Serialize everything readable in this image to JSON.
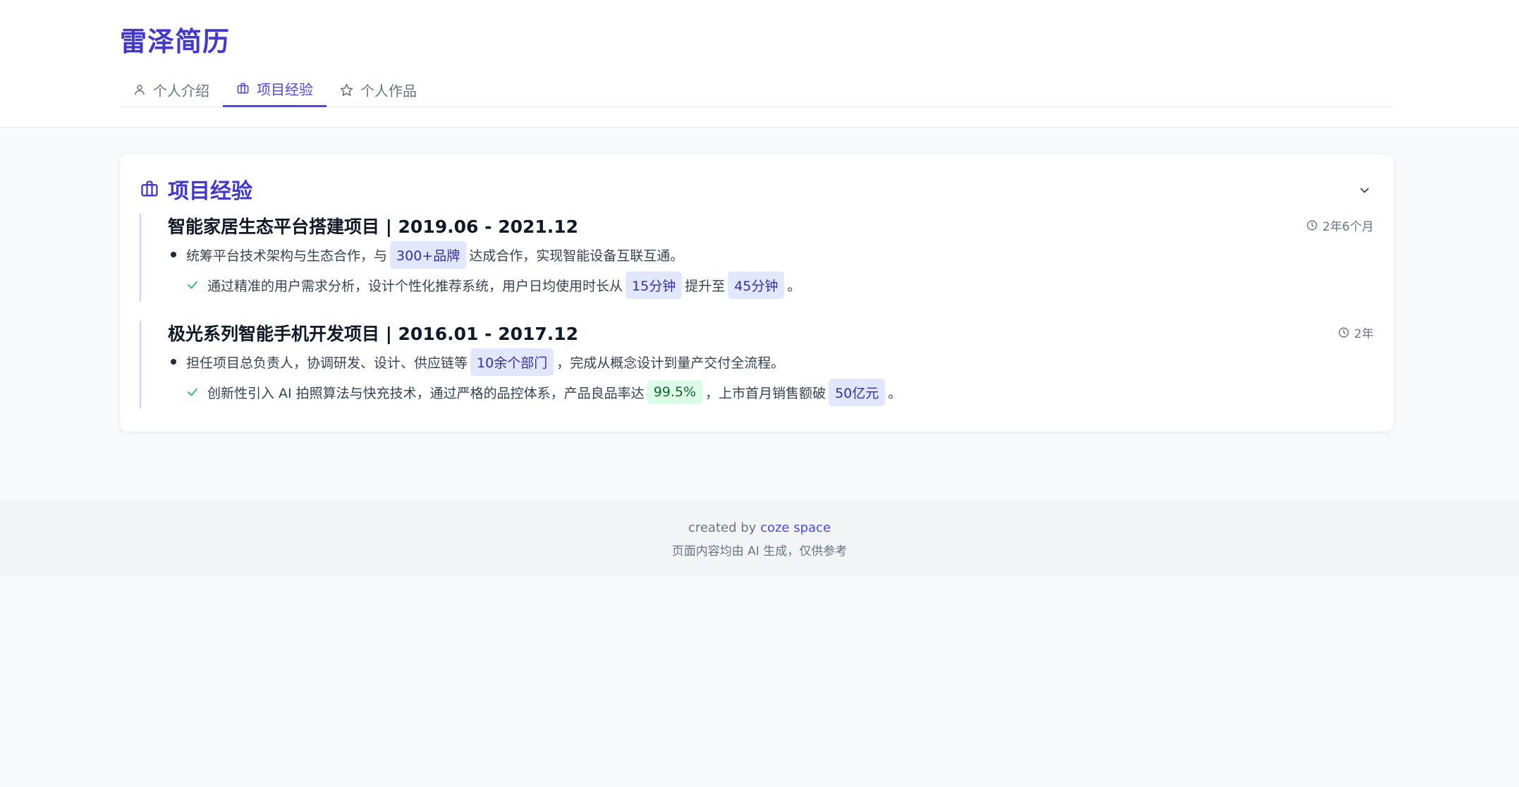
{
  "brand": "雷泽简历",
  "tabs": [
    {
      "label": "个人介绍",
      "icon": "user-icon",
      "active": false
    },
    {
      "label": "项目经验",
      "icon": "briefcase-icon",
      "active": true
    },
    {
      "label": "个人作品",
      "icon": "star-icon",
      "active": false
    }
  ],
  "section": {
    "title": "项目经验",
    "icon": "briefcase-icon"
  },
  "projects": [
    {
      "title": "智能家居生态平台搭建项目 | 2019.06 - 2021.12",
      "duration": "2年6个月",
      "bullet": {
        "pre": "统筹平台技术架构与生态合作，与",
        "tag": "300+品牌",
        "post": "达成合作，实现智能设备互联互通。"
      },
      "achievement": {
        "pre": "通过精准的用户需求分析，设计个性化推荐系统，用户日均使用时长从",
        "tag1": "15分钟",
        "mid": "提升至",
        "tag2": "45分钟",
        "post": "。"
      }
    },
    {
      "title": "极光系列智能手机开发项目 | 2016.01 - 2017.12",
      "duration": "2年",
      "bullet": {
        "pre": "担任项目总负责人，协调研发、设计、供应链等",
        "tag": "10余个部门",
        "post": "，完成从概念设计到量产交付全流程。"
      },
      "achievement": {
        "pre": "创新性引入 AI 拍照算法与快充技术，通过严格的品控体系，产品良品率达",
        "tag1": "99.5%",
        "mid": "，上市首月销售额破",
        "tag2": "50亿元",
        "post": "。"
      }
    }
  ],
  "footer": {
    "created_by": "created by",
    "link": "coze space",
    "disclaimer": "页面内容均由 AI 生成，仅供参考"
  },
  "colors": {
    "accent": "#4f46e5",
    "brand": "#4338ca",
    "tag_bg": "#e0e7ff",
    "tag_green_bg": "#dcfce7",
    "check": "#22c55e"
  }
}
